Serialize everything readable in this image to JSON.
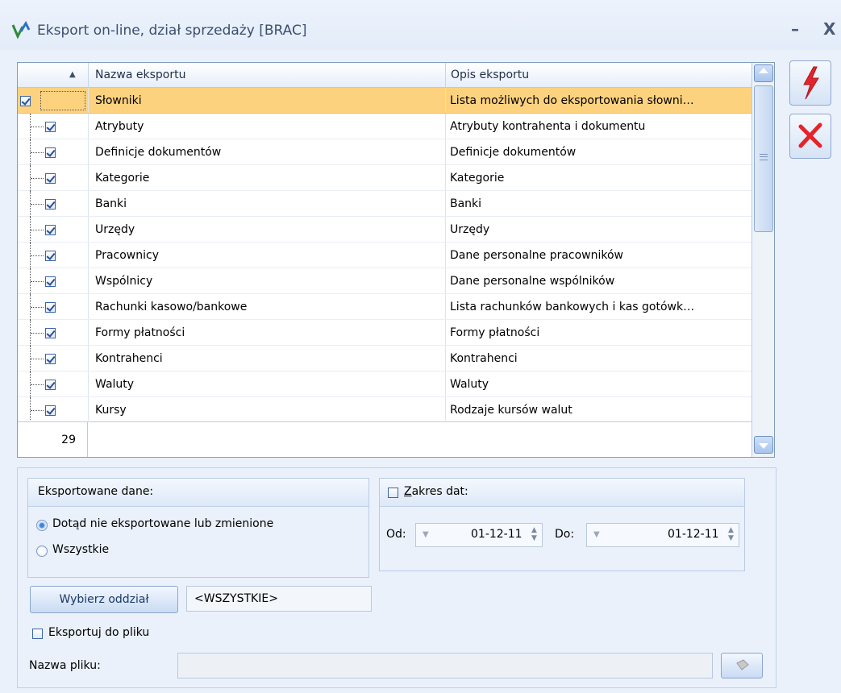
{
  "window": {
    "title": "Eksport on-line, dział sprzedaży [BRAC]",
    "minimize": "–",
    "close": "X"
  },
  "grid": {
    "columns": {
      "name": "Nazwa eksportu",
      "desc": "Opis eksportu"
    },
    "rows": [
      {
        "name": "Słowniki",
        "desc": "Lista możliwych do eksportowania słowni…",
        "checked": true,
        "root": true,
        "selected": true
      },
      {
        "name": "Atrybuty",
        "desc": "Atrybuty kontrahenta i dokumentu",
        "checked": true
      },
      {
        "name": "Definicje dokumentów",
        "desc": "Definicje dokumentów",
        "checked": true
      },
      {
        "name": "Kategorie",
        "desc": "Kategorie",
        "checked": true
      },
      {
        "name": "Banki",
        "desc": "Banki",
        "checked": true
      },
      {
        "name": "Urzędy",
        "desc": "Urzędy",
        "checked": true
      },
      {
        "name": "Pracownicy",
        "desc": "Dane personalne pracowników",
        "checked": true
      },
      {
        "name": "Wspólnicy",
        "desc": "Dane personalne wspólników",
        "checked": true
      },
      {
        "name": "Rachunki kasowo/bankowe",
        "desc": "Lista rachunków bankowych i kas gotówk…",
        "checked": true
      },
      {
        "name": "Formy płatności",
        "desc": "Formy płatności",
        "checked": true
      },
      {
        "name": "Kontrahenci",
        "desc": "Kontrahenci",
        "checked": true
      },
      {
        "name": "Waluty",
        "desc": "Waluty",
        "checked": true
      },
      {
        "name": "Kursy",
        "desc": "Rodzaje kursów walut",
        "checked": true
      }
    ],
    "count": "29"
  },
  "export_data": {
    "title": "Eksportowane dane:",
    "option1": "Dotąd nie eksportowane lub zmienione",
    "option2": "Wszystkie",
    "selected": 1
  },
  "date_range": {
    "title": "Zakres dat:",
    "from_label": "Od:",
    "from_value": "01-12-11",
    "to_label": "Do:",
    "to_value": "01-12-11"
  },
  "branch": {
    "button": "Wybierz oddział",
    "value": "<WSZYSTKIE>"
  },
  "file": {
    "export_checkbox": "Eksportuj do pliku",
    "name_label": "Nazwa pliku:",
    "name_value": ""
  },
  "colors": {
    "selected_row": "#fdd27f",
    "execute_icon": "#e3242b",
    "cancel_icon": "#e3242b"
  }
}
